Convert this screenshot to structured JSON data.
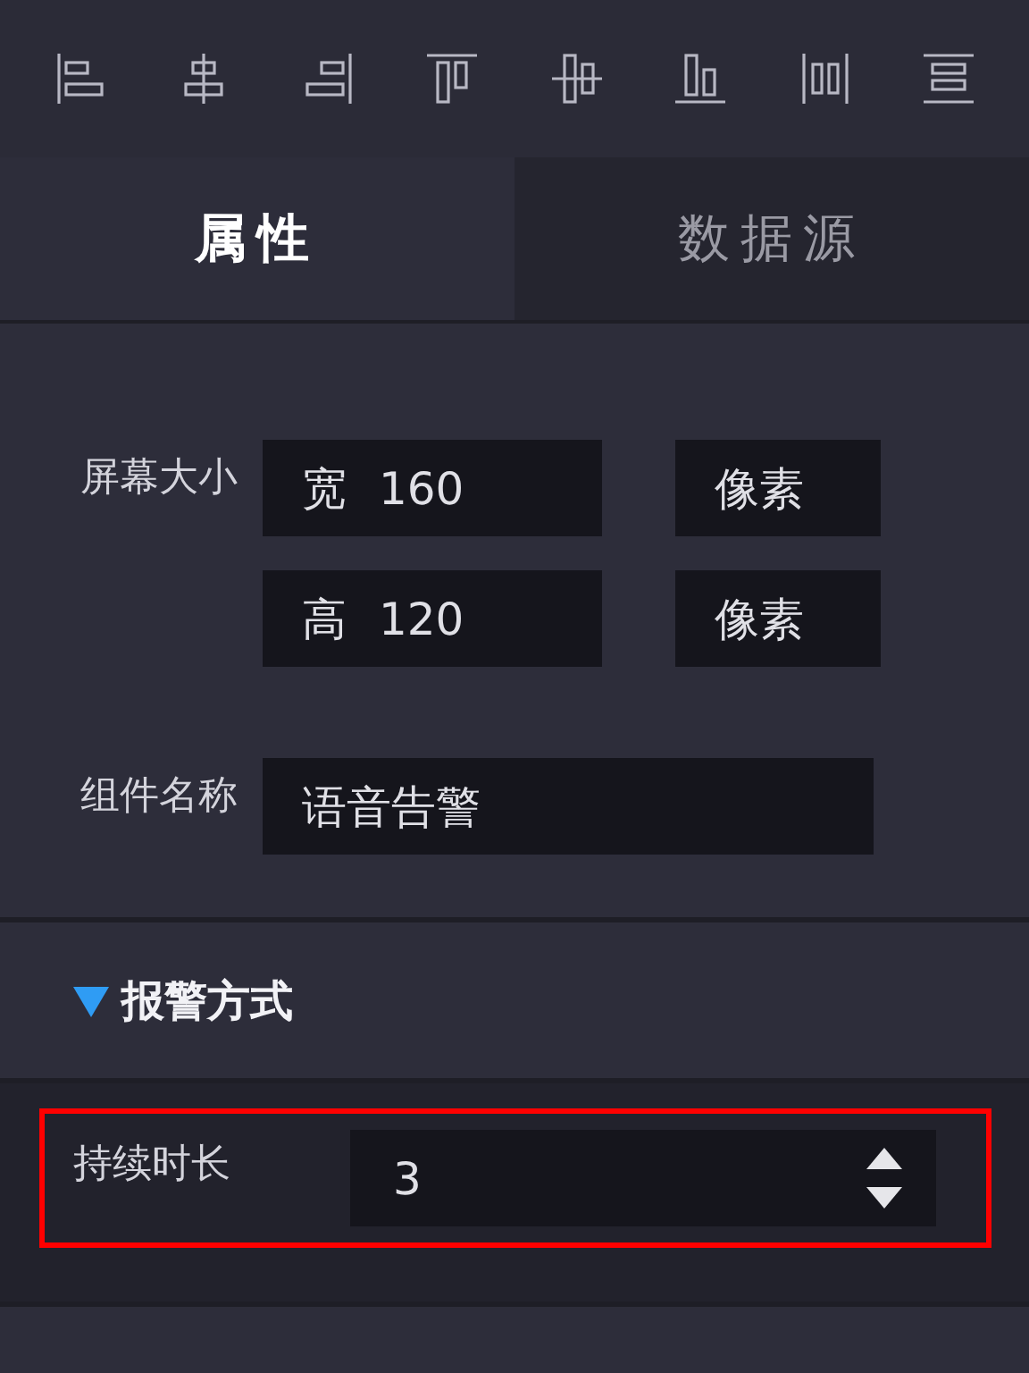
{
  "tabs": [
    {
      "label": "属性",
      "selected": true
    },
    {
      "label": "数据源",
      "selected": false
    }
  ],
  "screen_size": {
    "label": "屏幕大小",
    "rows": [
      {
        "prefix": "宽",
        "value": "160",
        "unit": "像素"
      },
      {
        "prefix": "高",
        "value": "120",
        "unit": "像素"
      }
    ]
  },
  "component_name": {
    "label": "组件名称",
    "value": "语音告警"
  },
  "sections": [
    {
      "title": "报警方式",
      "expanded": true,
      "fields": [
        {
          "label": "持续时长",
          "value": "3",
          "kind": "spinner",
          "highlighted": true
        }
      ]
    }
  ]
}
